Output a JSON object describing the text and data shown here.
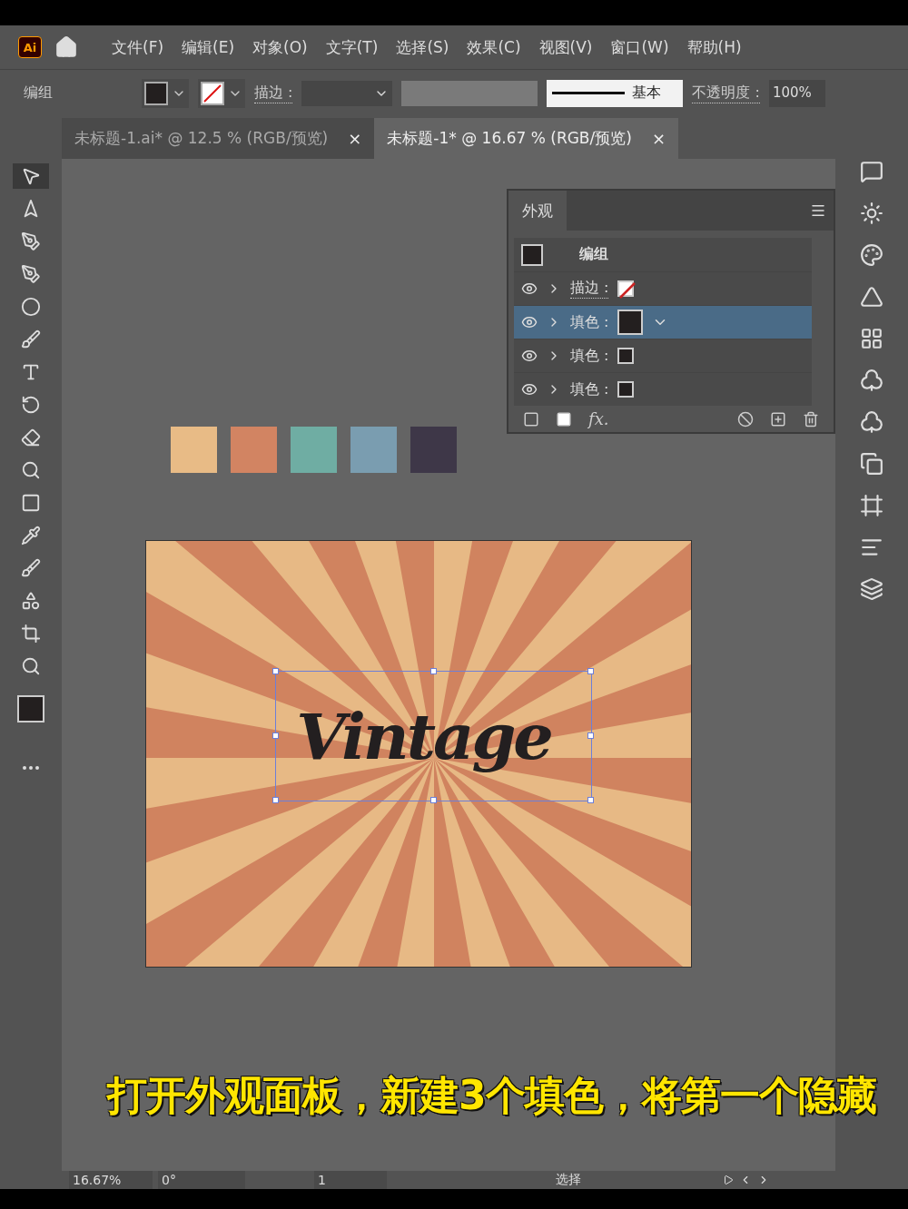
{
  "app_logo": "Ai",
  "menu": [
    "文件(F)",
    "编辑(E)",
    "对象(O)",
    "文字(T)",
    "选择(S)",
    "效果(C)",
    "视图(V)",
    "窗口(W)",
    "帮助(H)"
  ],
  "control_bar": {
    "selection_label": "编组",
    "stroke_label": "描边 :",
    "stroke_profile": "基本",
    "opacity_label": "不透明度 :",
    "opacity_value": "100%"
  },
  "tabs": [
    {
      "label": "未标题-1.ai* @ 12.5 % (RGB/预览)",
      "selected": false,
      "close": "×"
    },
    {
      "label": "未标题-1* @ 16.67 % (RGB/预览)",
      "selected": true,
      "close": "×"
    }
  ],
  "swatches": [
    {
      "color": "#e8bb86"
    },
    {
      "color": "#d28462"
    },
    {
      "color": "#6fada3"
    },
    {
      "color": "#7a9db0"
    },
    {
      "color": "#3e3748"
    }
  ],
  "artwork_text": "Vintage",
  "appearance_panel": {
    "title": "外观",
    "header_label": "编组",
    "effects_label": "fx.",
    "rows": [
      {
        "kind": "stroke",
        "label": "描边 :",
        "selected": false
      },
      {
        "kind": "fill",
        "label": "填色 :",
        "selected": true
      },
      {
        "kind": "fill",
        "label": "填色 :",
        "selected": false
      },
      {
        "kind": "fill",
        "label": "填色 :",
        "selected": false
      }
    ]
  },
  "caption": "打开外观面板，新建3个填色，将第一个隐藏",
  "status_bar": {
    "zoom": "16.67%",
    "rotation": "0°",
    "artboard": "1",
    "tool": "选择"
  }
}
